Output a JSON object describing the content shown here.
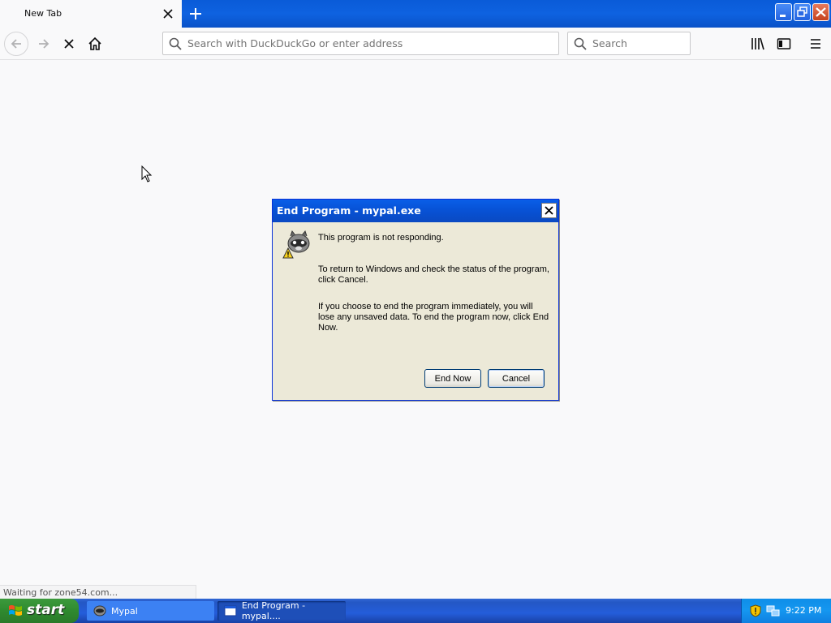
{
  "browser": {
    "tab_title": "New Tab",
    "url_placeholder": "Search with DuckDuckGo or enter address",
    "search_placeholder": "Search",
    "status_text": "Waiting for zone54.com..."
  },
  "dialog": {
    "title": "End Program - mypal.exe",
    "message_1": "This program is not responding.",
    "message_2": "To return to Windows and check the status of the program, click Cancel.",
    "message_3": "If you choose to end the program immediately, you will lose any unsaved data. To end the program now, click End Now.",
    "end_now_label": "End Now",
    "cancel_label": "Cancel"
  },
  "taskbar": {
    "start_label": "start",
    "tasks": [
      {
        "label": "Mypal"
      },
      {
        "label": "End Program - mypal...."
      }
    ],
    "clock": "9:22 PM"
  },
  "icons": {
    "tab_close": "close-icon",
    "new_tab": "plus-icon",
    "back": "arrow-left-icon",
    "forward": "arrow-right-icon",
    "stop": "stop-x-icon",
    "home": "home-icon",
    "search": "magnifier-icon",
    "library": "library-icon",
    "sidebar": "sidebar-icon",
    "menu": "hamburger-menu-icon"
  },
  "colors": {
    "xp_blue": "#0a5fe8",
    "dialog_bg": "#ece9d8",
    "start_green": "#3c9a3c",
    "page_bg": "#f9f9fa"
  }
}
